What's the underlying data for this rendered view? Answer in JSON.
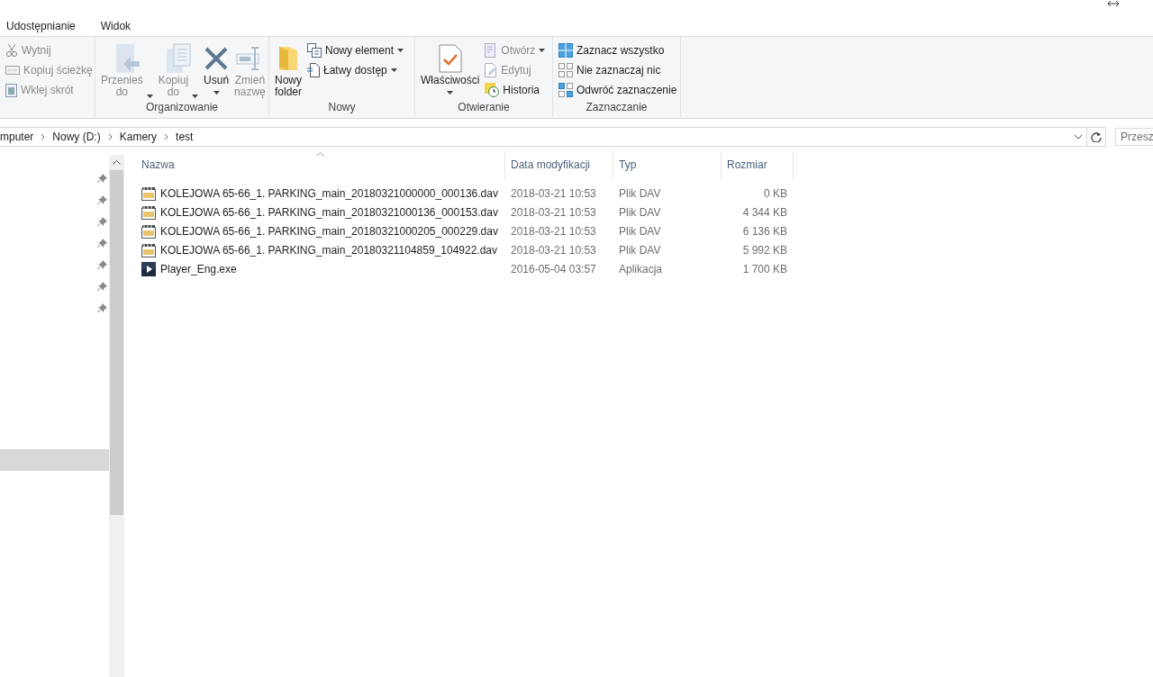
{
  "ribbon_tabs": [
    {
      "label": "Udostępnianie"
    },
    {
      "label": "Widok"
    }
  ],
  "ribbon_groups": [
    {
      "items": [
        {
          "label": "Wytnij",
          "kind": "small",
          "disabled": true,
          "dropdown": false
        },
        {
          "label": "Kopiuj ścieżkę",
          "kind": "small",
          "disabled": true,
          "dropdown": false
        },
        {
          "label": "Wklej skrót",
          "kind": "small",
          "disabled": true,
          "dropdown": false
        }
      ]
    },
    {
      "label": "Organizowanie",
      "items": [
        {
          "label": "Przenieś do",
          "kind": "large",
          "disabled": true,
          "dropdown": true
        },
        {
          "label": "Kopiuj do",
          "kind": "large",
          "disabled": true,
          "dropdown": true
        },
        {
          "label": "Usuń",
          "kind": "large",
          "disabled": false,
          "dropdown": true
        },
        {
          "label": "Zmień nazwę",
          "kind": "large",
          "disabled": true,
          "dropdown": false
        }
      ]
    },
    {
      "label": "Nowy",
      "items": [
        {
          "label": "Nowy folder",
          "kind": "large",
          "disabled": false,
          "dropdown": false
        },
        {
          "label": "Nowy element",
          "kind": "small",
          "disabled": false,
          "dropdown": true
        },
        {
          "label": "Łatwy dostęp",
          "kind": "small",
          "disabled": false,
          "dropdown": true
        }
      ]
    },
    {
      "label": "Otwieranie",
      "items": [
        {
          "label": "Właściwości",
          "kind": "large",
          "disabled": false,
          "dropdown": true
        },
        {
          "label": "Otwórz",
          "kind": "small",
          "disabled": true,
          "dropdown": true
        },
        {
          "label": "Edytuj",
          "kind": "small",
          "disabled": true,
          "dropdown": false
        },
        {
          "label": "Historia",
          "kind": "small",
          "disabled": false,
          "dropdown": false
        }
      ]
    },
    {
      "label": "Zaznaczanie",
      "items": [
        {
          "label": "Zaznacz wszystko",
          "kind": "small",
          "disabled": false,
          "dropdown": false
        },
        {
          "label": "Nie zaznaczaj nic",
          "kind": "small",
          "disabled": false,
          "dropdown": false
        },
        {
          "label": "Odwróć zaznaczenie",
          "kind": "small",
          "disabled": false,
          "dropdown": false
        }
      ]
    }
  ],
  "address_bar": {
    "breadcrumbs": [
      "mputer",
      "Nowy (D:)",
      "Kamery",
      "test"
    ],
    "search_placeholder": "Przesz"
  },
  "nav_pane": {
    "items": [
      {
        "pinned": true,
        "selected": false
      },
      {
        "pinned": true,
        "selected": false
      },
      {
        "pinned": true,
        "selected": false
      },
      {
        "pinned": true,
        "selected": false
      },
      {
        "pinned": true,
        "selected": false
      },
      {
        "pinned": true,
        "selected": false
      },
      {
        "pinned": true,
        "selected": false
      },
      {
        "pinned": false,
        "selected": true
      }
    ]
  },
  "file_list": {
    "columns": [
      "Nazwa",
      "Data modyfikacji",
      "Typ",
      "Rozmiar"
    ],
    "rows": [
      {
        "kind": "video",
        "name": "KOLEJOWA 65-66_1. PARKING_main_20180321000000_000136.dav",
        "modified": "2018-03-21 10:53",
        "type": "Plik DAV",
        "size": "0 KB"
      },
      {
        "kind": "video",
        "name": "KOLEJOWA 65-66_1. PARKING_main_20180321000136_000153.dav",
        "modified": "2018-03-21 10:53",
        "type": "Plik DAV",
        "size": "4 344 KB"
      },
      {
        "kind": "video",
        "name": "KOLEJOWA 65-66_1. PARKING_main_20180321000205_000229.dav",
        "modified": "2018-03-21 10:53",
        "type": "Plik DAV",
        "size": "6 136 KB"
      },
      {
        "kind": "video",
        "name": "KOLEJOWA 65-66_1. PARKING_main_20180321104859_104922.dav",
        "modified": "2018-03-21 10:53",
        "type": "Plik DAV",
        "size": "5 992 KB"
      },
      {
        "kind": "app",
        "name": "Player_Eng.exe",
        "modified": "2016-05-04 03:57",
        "type": "Aplikacja",
        "size": "1 700 KB"
      }
    ]
  }
}
